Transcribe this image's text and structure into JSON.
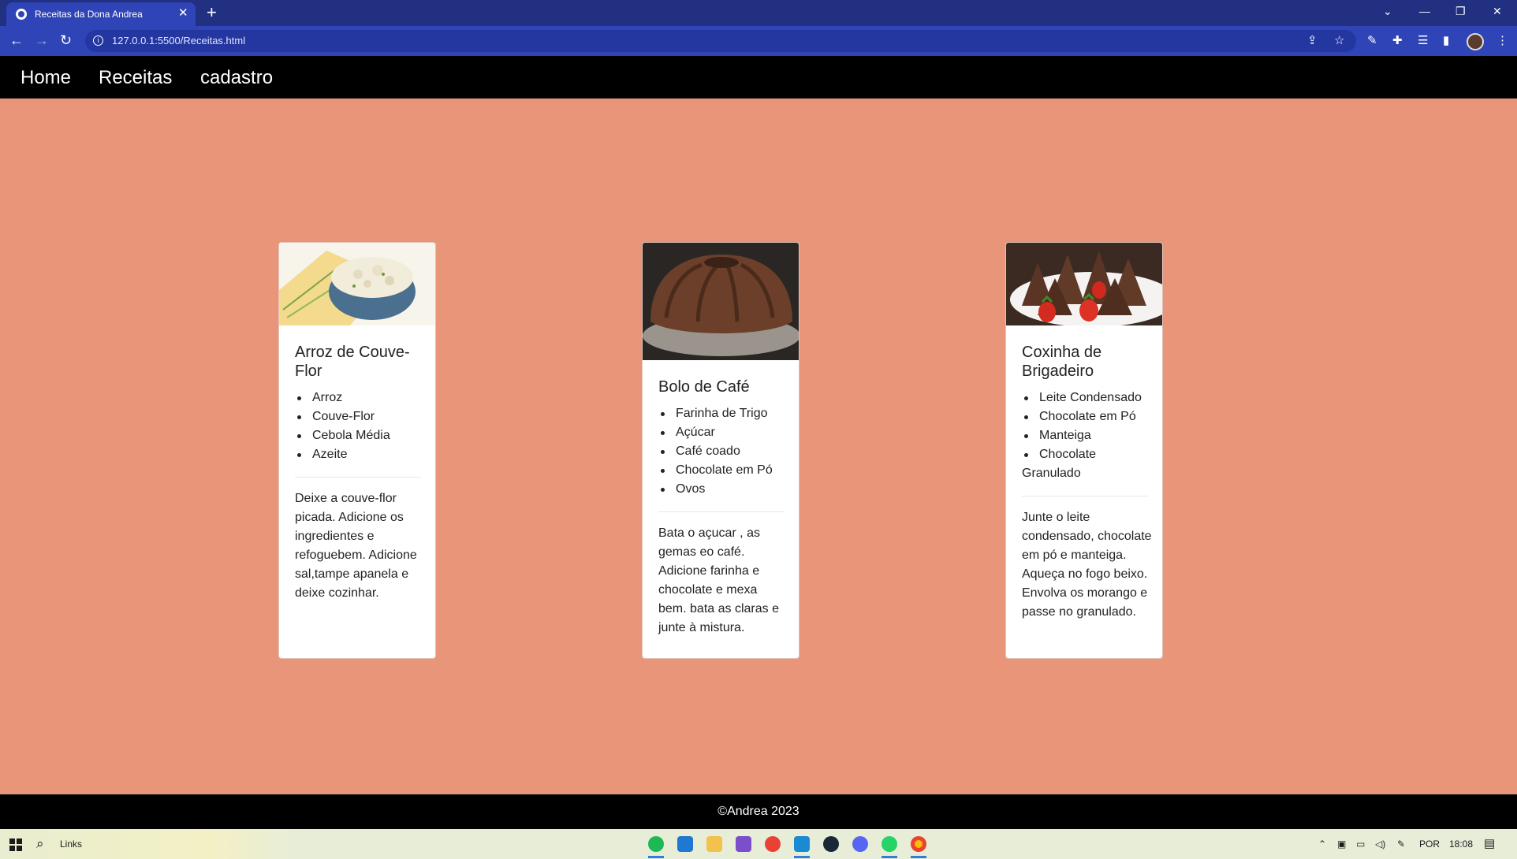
{
  "browser": {
    "tab_title": "Receitas da Dona Andrea",
    "tab_close": "✕",
    "new_tab": "+",
    "url": "127.0.0.1:5500/Receitas.html",
    "window_controls": [
      "⌄",
      "—",
      "❐",
      "✕"
    ]
  },
  "nav": {
    "links": [
      "Home",
      "Receitas",
      "cadastro"
    ]
  },
  "recipes": [
    {
      "title": "Arroz de Couve-Flor",
      "ingredients": [
        "Arroz",
        "Couve-Flor",
        "Cebola Média",
        "Azeite"
      ],
      "instructions": "Deixe a couve-flor picada. Adicione os ingredientes e refoguebem. Adicione sal,tampe apanela e deixe cozinhar."
    },
    {
      "title": "Bolo de Café",
      "ingredients": [
        "Farinha de Trigo",
        "Açúcar",
        "Café coado",
        "Chocolate em Pó",
        "Ovos"
      ],
      "instructions": "Bata o açucar , as gemas eo café. Adicione farinha e chocolate e mexa bem. bata as claras e junte à mistura."
    },
    {
      "title": "Coxinha de Brigadeiro",
      "ingredients": [
        "Leite Condensado",
        "Chocolate em Pó",
        "Manteiga",
        "Chocolate Granulado"
      ],
      "instructions": "Junte o leite condensado, chocolate em pó e manteiga. Aqueça no fogo beixo. Envolva os morango e passe no granulado."
    }
  ],
  "footer": {
    "text": "©Andrea 2023"
  },
  "taskbar": {
    "search_label": "Links",
    "language": "POR",
    "time": "18:08"
  },
  "colors": {
    "page_background": "#e9957a",
    "nav_background": "#000000",
    "browser_chrome": "#2f44b6"
  }
}
